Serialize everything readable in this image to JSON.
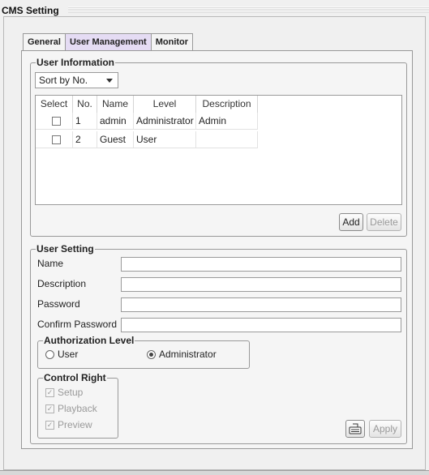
{
  "window": {
    "title": "CMS Setting"
  },
  "tabs": [
    {
      "label": "General"
    },
    {
      "label": "User Management"
    },
    {
      "label": "Monitor"
    }
  ],
  "user_information": {
    "legend": "User Information",
    "sort_select": {
      "selected": "Sort by No."
    },
    "table": {
      "headers": [
        "Select",
        "No.",
        "Name",
        "Level",
        "Description"
      ],
      "rows": [
        {
          "select": false,
          "no": "1",
          "name": "admin",
          "level": "Administrator",
          "description": "Admin"
        },
        {
          "select": false,
          "no": "2",
          "name": "Guest",
          "level": "User",
          "description": ""
        }
      ]
    },
    "add_label": "Add",
    "delete_label": "Delete"
  },
  "user_setting": {
    "legend": "User Setting",
    "name_label": "Name",
    "name_value": "",
    "description_label": "Description",
    "description_value": "",
    "password_label": "Password",
    "password_value": "",
    "confirm_password_label": "Confirm Password",
    "confirm_password_value": "",
    "authorization": {
      "legend": "Authorization Level",
      "options": [
        "User",
        "Administrator"
      ],
      "selected": "Administrator"
    },
    "control_right": {
      "legend": "Control Right",
      "items": [
        {
          "label": "Setup",
          "checked": true
        },
        {
          "label": "Playback",
          "checked": true
        },
        {
          "label": "Preview",
          "checked": true
        }
      ]
    },
    "keyboard_icon": "keyboard-icon",
    "apply_label": "Apply"
  },
  "colors": {
    "active_tab": "#e5dcf4",
    "window_bg": "#f0f0f0",
    "disabled_text": "#9a9a9a"
  }
}
